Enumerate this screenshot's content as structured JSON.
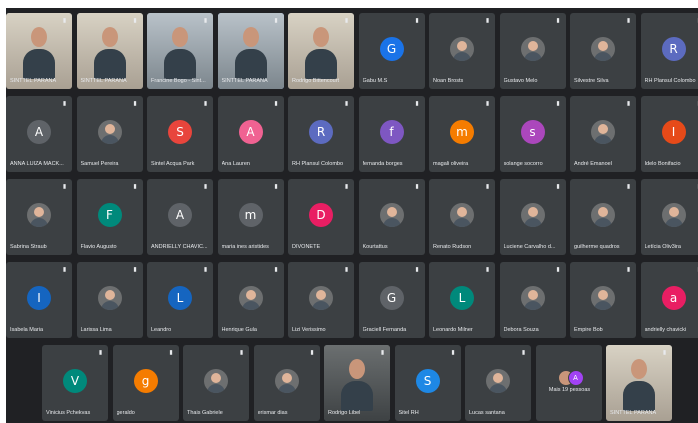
{
  "rows": [
    [
      {
        "name": "SINTTEL PARANÁ",
        "kind": "camera",
        "bg": "bg-a"
      },
      {
        "name": "SINTTEL PARANÁ",
        "kind": "camera",
        "bg": "bg-a"
      },
      {
        "name": "Francine Bogo - Sint...",
        "kind": "camera",
        "bg": "bg-b"
      },
      {
        "name": "SINTTEL PARANÁ",
        "kind": "camera",
        "bg": "bg-b",
        "active": true
      },
      {
        "name": "Rodrigo Bittencourt",
        "kind": "camera",
        "bg": "bg-a"
      },
      {
        "name": "Gabu M.S",
        "kind": "letter",
        "letter": "G",
        "color": "#1a73e8"
      },
      {
        "name": "Noan Brosts",
        "kind": "photo"
      },
      {
        "name": "Gustavo Melo",
        "kind": "photo"
      },
      {
        "name": "Silvestre Silva",
        "kind": "photo"
      },
      {
        "name": "RH Plansul Colombo",
        "kind": "letter",
        "letter": "R",
        "color": "#5c6bc0"
      }
    ],
    [
      {
        "name": "ANNA LUIZA MACK...",
        "kind": "letter",
        "letter": "A",
        "color": "#5f6368"
      },
      {
        "name": "Samuel Pereira",
        "kind": "photo"
      },
      {
        "name": "Sintel Acqua Park",
        "kind": "letter",
        "letter": "S",
        "color": "#e8453c"
      },
      {
        "name": "Ana Lauren",
        "kind": "letter",
        "letter": "A",
        "color": "#f06292"
      },
      {
        "name": "RH Plansul Colombo",
        "kind": "letter",
        "letter": "R",
        "color": "#5c6bc0"
      },
      {
        "name": "fernanda borges",
        "kind": "letter",
        "letter": "f",
        "color": "#7e57c2"
      },
      {
        "name": "magali oliveira",
        "kind": "letter",
        "letter": "m",
        "color": "#f57c00"
      },
      {
        "name": "solange socorro",
        "kind": "letter",
        "letter": "s",
        "color": "#ab47bc"
      },
      {
        "name": "André Emanoel",
        "kind": "photo"
      },
      {
        "name": "Idelo Bonifacio",
        "kind": "letter",
        "letter": "I",
        "color": "#e64a19"
      }
    ],
    [
      {
        "name": "Sabrina Straub",
        "kind": "photo"
      },
      {
        "name": "Flavio Augusto",
        "kind": "letter",
        "letter": "F",
        "color": "#00897b"
      },
      {
        "name": "ANDRIELLY CHAVIC...",
        "kind": "letter",
        "letter": "A",
        "color": "#5f6368"
      },
      {
        "name": "maria ines aristides",
        "kind": "letter",
        "letter": "m",
        "color": "#5f6368"
      },
      {
        "name": "DIVONETE",
        "kind": "letter",
        "letter": "D",
        "color": "#e91e63"
      },
      {
        "name": "Kourtattus",
        "kind": "photo"
      },
      {
        "name": "Renato Rudson",
        "kind": "photo"
      },
      {
        "name": "Luciene Carvalho d...",
        "kind": "photo"
      },
      {
        "name": "guilherme quadros",
        "kind": "photo"
      },
      {
        "name": "Letícia Oliv3ira",
        "kind": "photo"
      }
    ],
    [
      {
        "name": "Isabela Maria",
        "kind": "letter",
        "letter": "I",
        "color": "#1565c0"
      },
      {
        "name": "Larissa Lima",
        "kind": "photo"
      },
      {
        "name": "Leandro",
        "kind": "letter",
        "letter": "L",
        "color": "#1565c0"
      },
      {
        "name": "Henrique Gula",
        "kind": "photo"
      },
      {
        "name": "Lizi Verissimo",
        "kind": "photo"
      },
      {
        "name": "Graciell Fernanda",
        "kind": "letter",
        "letter": "G",
        "color": "#5f6368"
      },
      {
        "name": "Leonardo Milner",
        "kind": "letter",
        "letter": "L",
        "color": "#00897b"
      },
      {
        "name": "Debora Souza",
        "kind": "photo"
      },
      {
        "name": "Empire Bob",
        "kind": "photo"
      },
      {
        "name": "andrielly chavicki",
        "kind": "letter",
        "letter": "a",
        "color": "#e91e63"
      }
    ],
    [
      {
        "name": "Vinicius Pchekvas",
        "kind": "letter",
        "letter": "V",
        "color": "#00897b"
      },
      {
        "name": "geraldo",
        "kind": "letter",
        "letter": "g",
        "color": "#f57c00"
      },
      {
        "name": "Thais Gabriele",
        "kind": "photo"
      },
      {
        "name": "erismar dias",
        "kind": "photo"
      },
      {
        "name": "Rodrigo Libel",
        "kind": "camera",
        "bg": "bg-c"
      },
      {
        "name": "Sitel RH",
        "kind": "letter",
        "letter": "S",
        "color": "#1e88e5"
      },
      {
        "name": "Lucas santana",
        "kind": "photo"
      },
      {
        "name": "Mais 19 pessoas",
        "kind": "more",
        "letter": "A"
      },
      {
        "name": "SINTTEL PARANÁ",
        "kind": "camera",
        "bg": "bg-a"
      }
    ]
  ],
  "mic_symbol": "🎙"
}
